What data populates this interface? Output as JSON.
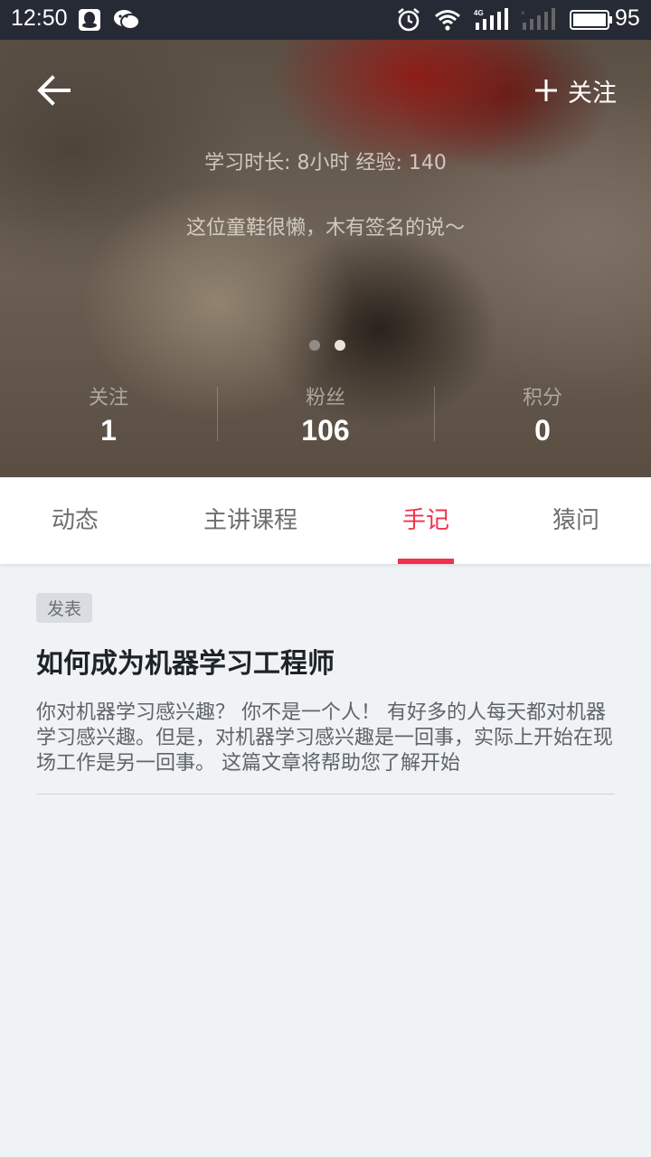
{
  "status_bar": {
    "time": "12:50",
    "battery": "95",
    "icons": [
      "qq-icon",
      "wechat-icon",
      "alarm-icon",
      "wifi-icon",
      "signal-4g-icon",
      "signal-no-sim-icon",
      "battery-icon"
    ]
  },
  "header": {
    "follow_label": "关注",
    "study_info": "学习时长: 8小时  经验: 140",
    "signature": "这位童鞋很懒，木有签名的说～",
    "stats": [
      {
        "label": "关注",
        "value": "1"
      },
      {
        "label": "粉丝",
        "value": "106"
      },
      {
        "label": "积分",
        "value": "0"
      }
    ],
    "pager": {
      "count": 2,
      "active": 2
    }
  },
  "tabs": [
    {
      "label": "动态"
    },
    {
      "label": "主讲课程"
    },
    {
      "label": "手记",
      "active": true
    },
    {
      "label": "猿问"
    }
  ],
  "notes": [
    {
      "tag": "发表",
      "title": "如何成为机器学习工程师",
      "excerpt": "你对机器学习感兴趣？ 你不是一个人！ 有好多的人每天都对机器学习感兴趣。但是，对机器学习感兴趣是一回事，实际上开始在现场工作是另一回事。 这篇文章将帮助您了解开始"
    }
  ],
  "colors": {
    "accent": "#f2324c",
    "status_bar_bg": "#262a35",
    "content_bg": "#f0f3f5"
  }
}
